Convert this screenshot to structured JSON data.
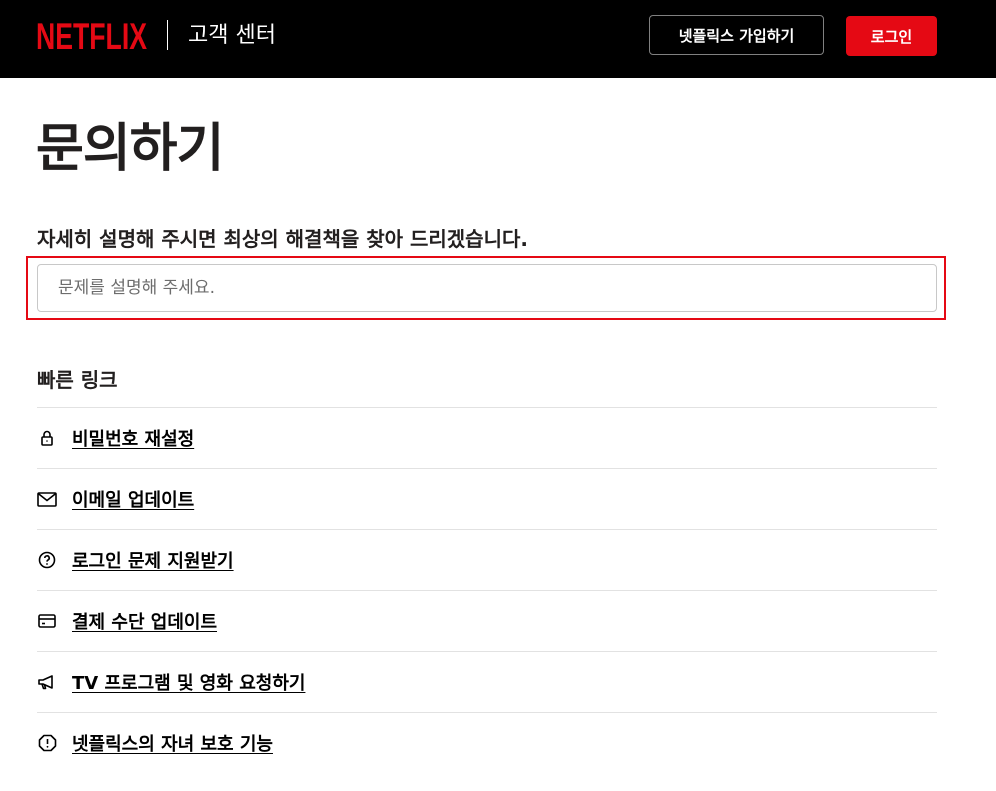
{
  "header": {
    "logo_text": "NETFLIX",
    "subtitle": "고객 센터",
    "signup_label": "넷플릭스 가입하기",
    "login_label": "로그인",
    "brand_color": "#e50914"
  },
  "main": {
    "title": "문의하기",
    "prompt": "자세히 설명해 주시면 최상의 해결책을 찾아 드리겠습니다.",
    "search": {
      "placeholder": "문제를 설명해 주세요.",
      "value": ""
    }
  },
  "quick_links": {
    "title": "빠른 링크",
    "items": [
      {
        "icon": "lock-icon",
        "label": "비밀번호 재설정"
      },
      {
        "icon": "mail-icon",
        "label": "이메일 업데이트"
      },
      {
        "icon": "question-circle-icon",
        "label": "로그인 문제 지원받기"
      },
      {
        "icon": "credit-card-icon",
        "label": "결제 수단 업데이트"
      },
      {
        "icon": "megaphone-icon",
        "label": "TV 프로그램 및 영화 요청하기"
      },
      {
        "icon": "shield-alert-icon",
        "label": "넷플릭스의 자녀 보호 기능"
      }
    ]
  }
}
